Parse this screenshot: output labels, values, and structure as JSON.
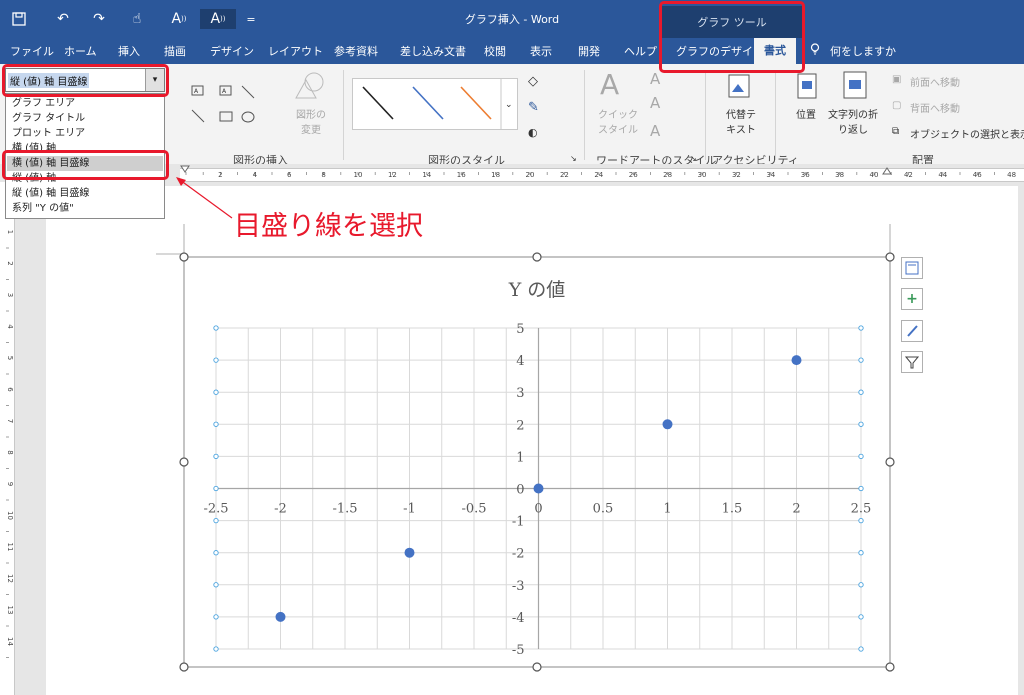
{
  "app": {
    "title": "グラフ挿入  -  Word",
    "context_group": "グラフ ツール",
    "quick_access": [
      "save-icon",
      "undo-icon",
      "redo-icon",
      "touch-mode-icon",
      "read-aloud-icon"
    ]
  },
  "tabs": [
    "ファイル",
    "ホーム",
    "挿入",
    "描画",
    "デザイン",
    "レイアウト",
    "参考資料",
    "差し込み文書",
    "校閲",
    "表示",
    "開発",
    "ヘルプ",
    "グラフのデザイン",
    "書式"
  ],
  "active_tab": "書式",
  "tell_me": "何をしますか",
  "ribbon": {
    "groups": {
      "insert_shapes": "図形の挿入",
      "shape_styles": "図形のスタイル",
      "wordart_styles": "ワードアートのスタイル",
      "accessibility": "アクセシビリティ",
      "arrange": "配置"
    },
    "change_shape": "図形の\n変更",
    "quick_styles": "クイック\nスタイル",
    "alt_text": "代替テ\nキスト",
    "position": "位置",
    "wrap_text": "文字列の折\nり返し",
    "bring_forward": "前面へ移動",
    "send_backward": "背面へ移動",
    "selection_pane": "オブジェクトの選択と表示"
  },
  "element_selector": {
    "current": "縦 (値) 軸 目盛線",
    "options": [
      "グラフ エリア",
      "グラフ タイトル",
      "プロット エリア",
      "横 (値) 軸",
      "横 (値) 軸 目盛線",
      "縦 (値) 軸",
      "縦 (値) 軸 目盛線",
      "系列 \"Y の値\""
    ],
    "highlighted_index": 4
  },
  "annotation": "目盛り線を選択",
  "ruler_labels": [
    "2",
    "4",
    "6",
    "8",
    "10",
    "12",
    "14",
    "16",
    "18",
    "20",
    "22",
    "24",
    "26",
    "28",
    "30",
    "32",
    "34",
    "36",
    "38",
    "40",
    "42",
    "44",
    "46",
    "48"
  ],
  "vruler_labels": [
    "1",
    "2",
    "3",
    "4",
    "5",
    "6",
    "7",
    "8",
    "9",
    "10",
    "11",
    "12",
    "13",
    "14"
  ],
  "chart_side_buttons": [
    "chart-layout-icon",
    "add-element-icon",
    "style-brush-icon",
    "filter-icon"
  ],
  "colors": {
    "accent": "#2b579a",
    "marker": "#4472c4",
    "highlight": "#e8192c"
  },
  "chart_data": {
    "type": "scatter",
    "title": "Y の値",
    "xlim": [
      -2.5,
      2.5
    ],
    "ylim": [
      -5,
      5
    ],
    "x_ticks": [
      "-2.5",
      "-2",
      "-1.5",
      "-1",
      "-0.5",
      "0",
      "0.5",
      "1",
      "1.5",
      "2",
      "2.5"
    ],
    "y_ticks": [
      "-5",
      "-4",
      "-3",
      "-2",
      "-1",
      "0",
      "1",
      "2",
      "3",
      "4",
      "5"
    ],
    "grid": true,
    "series": [
      {
        "x": [
          -2,
          -1,
          0,
          1,
          2
        ],
        "y": [
          -4,
          -2,
          0,
          2,
          4
        ]
      }
    ]
  }
}
